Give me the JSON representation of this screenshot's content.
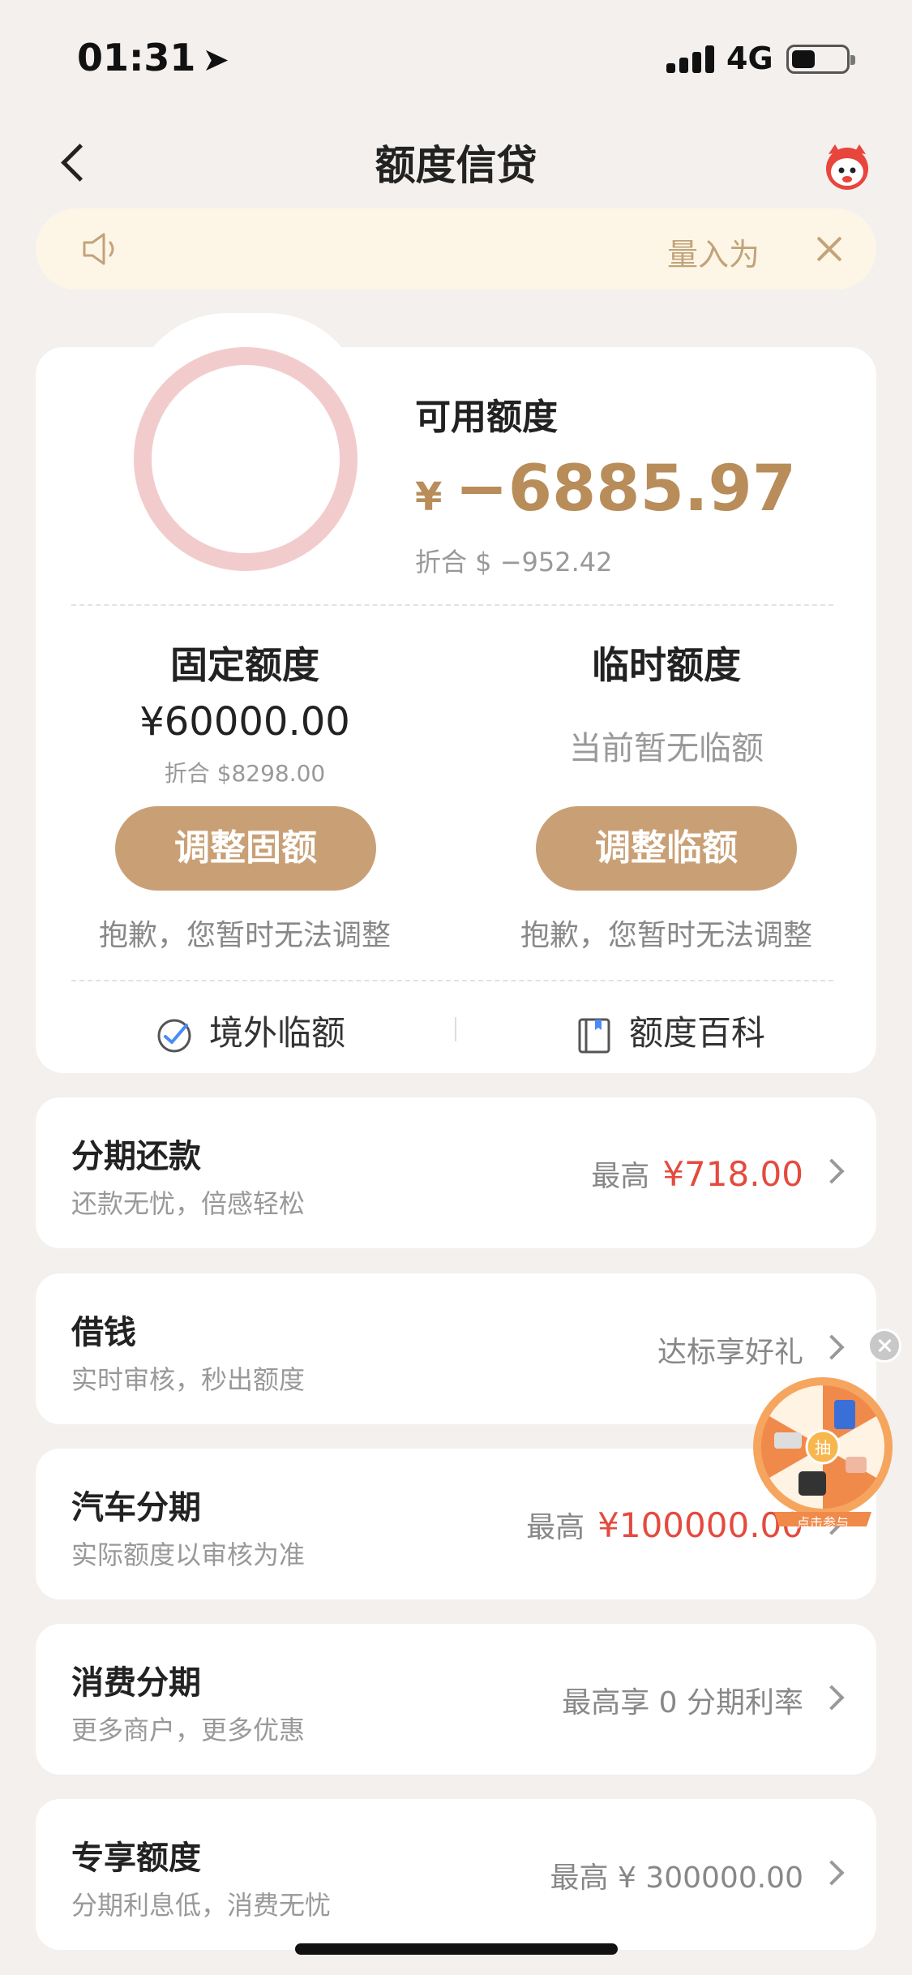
{
  "status_bar": {
    "time": "01:31",
    "network": "4G"
  },
  "nav": {
    "title": "额度信贷"
  },
  "notice": {
    "text": "量入为"
  },
  "quota": {
    "available_label": "可用额度",
    "currency_symbol": "¥",
    "available_amount": "−6885.97",
    "available_converted": "折合 $ −952.42",
    "fixed_title": "固定额度",
    "fixed_amount": "¥60000.00",
    "fixed_converted": "折合 $8298.00",
    "temp_title": "临时额度",
    "temp_status": "当前暂无临额",
    "adjust_fixed_label": "调整固额",
    "adjust_temp_label": "调整临额",
    "adjust_fixed_note": "抱歉，您暂时无法调整",
    "adjust_temp_note": "抱歉，您暂时无法调整",
    "overseas_label": "境外临额",
    "wiki_label": "额度百科"
  },
  "services": [
    {
      "title": "分期还款",
      "subtitle": "还款无忧，倍感轻松",
      "right_prefix": "最高",
      "right_value": "¥718.00"
    },
    {
      "title": "借钱",
      "subtitle": "实时审核，秒出额度",
      "right_prefix": "达标享好礼",
      "right_value": ""
    },
    {
      "title": "汽车分期",
      "subtitle": "实际额度以审核为准",
      "right_prefix": "最高",
      "right_value": "¥100000.00"
    },
    {
      "title": "消费分期",
      "subtitle": "更多商户，更多优惠",
      "right_prefix": "最高享 0 分期利率",
      "right_value": ""
    },
    {
      "title": "专享额度",
      "subtitle": "分期利息低，消费无忧",
      "right_prefix": "最高 ¥ 300000.00",
      "right_value": ""
    }
  ],
  "floating_wheel": {
    "center_label": "抽",
    "cta": "点击参与"
  },
  "colors": {
    "accent_gold": "#c9a075",
    "amount_gold": "#b88d5a",
    "price_red": "#e34b3f",
    "ring_pink": "#f2cccc",
    "background": "#f3f0ed"
  }
}
